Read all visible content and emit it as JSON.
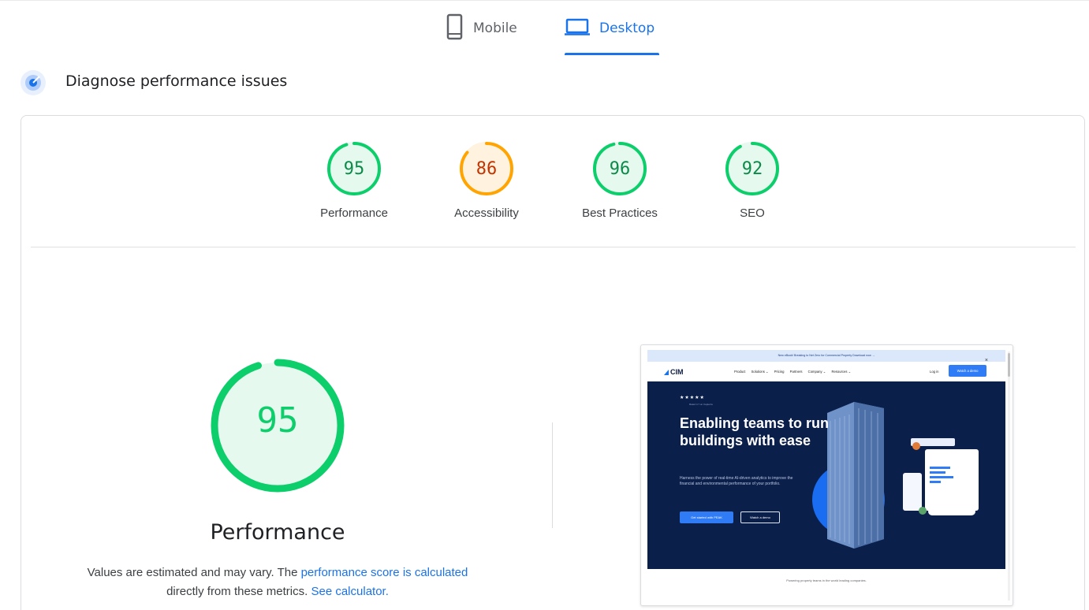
{
  "tabs": {
    "mobile_label": "Mobile",
    "desktop_label": "Desktop",
    "active": "Desktop"
  },
  "diagnose": {
    "title": "Diagnose performance issues"
  },
  "colors": {
    "pass": "#0cce6b",
    "average": "#ffa400",
    "accent": "#1a73e8"
  },
  "scores": [
    {
      "label": "Performance",
      "value": 95,
      "status": "pass"
    },
    {
      "label": "Accessibility",
      "value": 86,
      "status": "average"
    },
    {
      "label": "Best Practices",
      "value": 96,
      "status": "pass"
    },
    {
      "label": "SEO",
      "value": 92,
      "status": "pass"
    }
  ],
  "performance": {
    "score": 95,
    "title": "Performance",
    "note_prefix": "Values are estimated and may vary. The ",
    "note_link1": "performance score is calculated",
    "note_middle": " directly from these metrics. ",
    "note_link2": "See calculator."
  },
  "screenshot": {
    "banner": "New eBook! Breaking to Net Zero for Commercial Property  Download now →",
    "close": "×",
    "logo": "CIM",
    "nav": [
      "Product",
      "Solutions ⌄",
      "Pricing",
      "Partners",
      "Company ⌄",
      "Resources ⌄"
    ],
    "login": "Log in",
    "demo_button": "Watch a demo",
    "stars": "★★★★★",
    "stars_caption": "Rated 4.7 on Capterra",
    "headline": "Enabling teams to run buildings with ease",
    "subtext": "Harness the power of real-time AI-driven analytics to improve the financial and environmental performance of your portfolio.",
    "cta_primary": "Get started with PEAK",
    "cta_secondary": "Watch a demo",
    "footer": "Powering property teams in the world leading companies."
  }
}
